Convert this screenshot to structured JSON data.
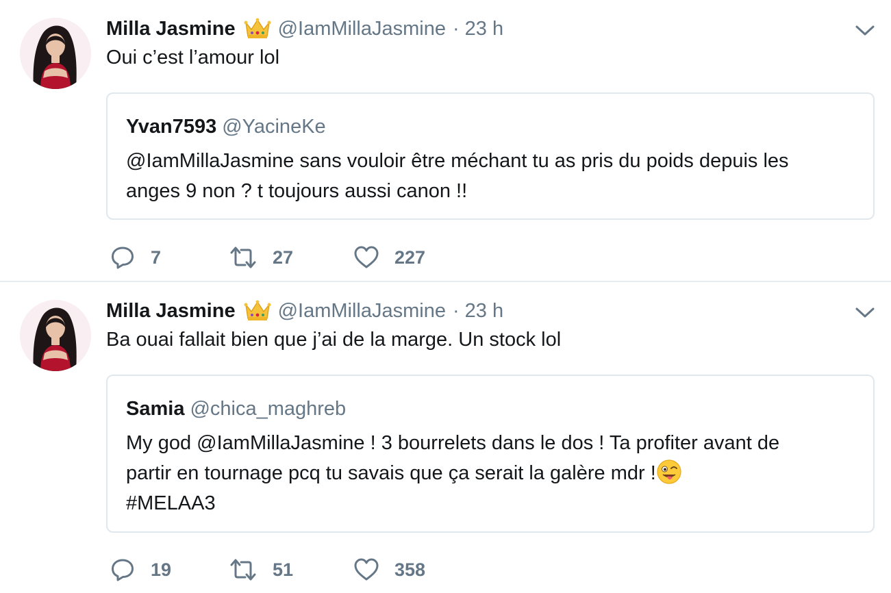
{
  "colors": {
    "text": "#14171a",
    "secondary": "#657786",
    "border": "#e1e8ed",
    "divider": "#e6ecf0"
  },
  "tweets": [
    {
      "author_name": "Milla Jasmine",
      "author_handle": "@IamMillaJasmine",
      "separator": "·",
      "time": "23 h",
      "badge_icon": "crown-emoji",
      "text": "Oui c’est l’amour lol",
      "quoted": {
        "name": "Yvan7593",
        "handle": "@YacineKe",
        "lines": [
          "@IamMillaJasmine sans vouloir être méchant tu as pris du poids depuis les",
          "anges 9 non ? t toujours aussi canon !!"
        ]
      },
      "replies": "7",
      "retweets": "27",
      "likes": "227"
    },
    {
      "author_name": "Milla Jasmine",
      "author_handle": "@IamMillaJasmine",
      "separator": "·",
      "time": "23 h",
      "badge_icon": "crown-emoji",
      "text": "Ba ouai fallait bien que j’ai de la marge. Un stock lol",
      "quoted": {
        "name": "Samia",
        "handle": "@chica_maghreb",
        "lines": [
          "My god @IamMillaJasmine ! 3 bourrelets dans le dos ! Ta profiter avant de",
          "partir en tournage pcq tu savais que ça serait la galère mdr !",
          "#MELAA3"
        ],
        "trailing_emoji_icon": "winking-tongue-emoji"
      },
      "replies": "19",
      "retweets": "51",
      "likes": "358"
    }
  ]
}
